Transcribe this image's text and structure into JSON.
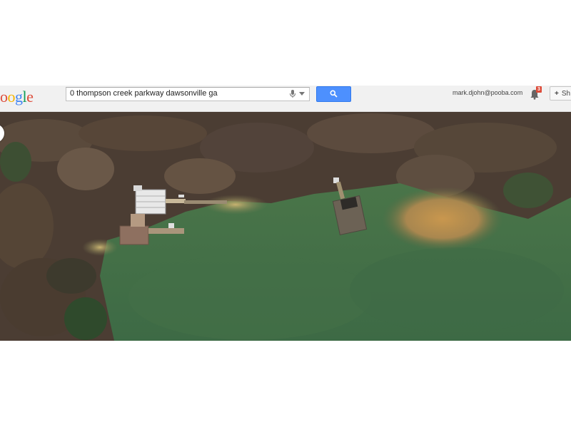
{
  "header": {
    "logo_letters": [
      {
        "ch": "o",
        "color": "#dd4b39"
      },
      {
        "ch": "o",
        "color": "#f4b400"
      },
      {
        "ch": "g",
        "color": "#4285f4"
      },
      {
        "ch": "l",
        "color": "#0f9d58"
      },
      {
        "ch": "e",
        "color": "#dd4b39"
      }
    ],
    "search": {
      "value": "0 thompson creek parkway dawsonville ga"
    },
    "user_email": "mark.djohn@pooba.com",
    "notifications_count": "3",
    "share_label": "Sh",
    "share_plus": "+"
  },
  "colors": {
    "search_button": "#4d90fe",
    "water": "#3f6b45",
    "forest": "#4a3a2e",
    "sand": "#c29a52",
    "notification_badge": "#dd4b39"
  },
  "map": {
    "view": "satellite",
    "icons": [
      "search-icon",
      "microphone-icon",
      "notification-bell-icon",
      "dock-structure",
      "boathouse"
    ]
  }
}
